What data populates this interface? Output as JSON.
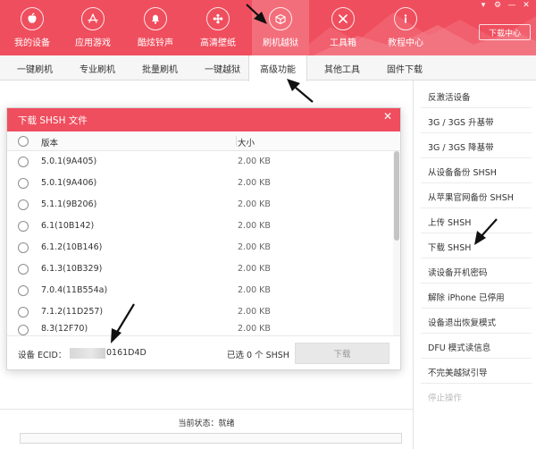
{
  "toolbar": {
    "items": [
      {
        "label": "我的设备",
        "icon": "apple-icon"
      },
      {
        "label": "应用游戏",
        "icon": "app-store-icon"
      },
      {
        "label": "酷炫铃声",
        "icon": "bell-icon"
      },
      {
        "label": "高清壁纸",
        "icon": "flower-icon"
      },
      {
        "label": "刷机越狱",
        "icon": "box-icon"
      },
      {
        "label": "工具箱",
        "icon": "tools-icon"
      },
      {
        "label": "教程中心",
        "icon": "info-icon"
      }
    ],
    "active_index": 4,
    "download_center": "下载中心",
    "accent_color": "#ef4e5e"
  },
  "subtabs": {
    "items": [
      "一键刷机",
      "专业刷机",
      "批量刷机",
      "一键越狱",
      "高级功能",
      "其他工具",
      "固件下载"
    ],
    "active_index": 4
  },
  "right_panel": {
    "items": [
      "反激活设备",
      "3G / 3GS 升基带",
      "3G / 3GS 降基带",
      "从设备备份 SHSH",
      "从苹果官网备份 SHSH",
      "上传 SHSH",
      "下载 SHSH",
      "读设备开机密码",
      "解除 iPhone 已停用",
      "设备退出恢复模式",
      "DFU 模式读信息",
      "不完美越狱引导",
      "停止操作"
    ],
    "disabled_last": true
  },
  "dialog": {
    "title": "下载 SHSH 文件",
    "columns": {
      "version": "版本",
      "size": "大小"
    },
    "rows": [
      {
        "version": "5.0.1(9A405)",
        "size": "2.00 KB"
      },
      {
        "version": "5.0.1(9A406)",
        "size": "2.00 KB"
      },
      {
        "version": "5.1.1(9B206)",
        "size": "2.00 KB"
      },
      {
        "version": "6.1(10B142)",
        "size": "2.00 KB"
      },
      {
        "version": "6.1.2(10B146)",
        "size": "2.00 KB"
      },
      {
        "version": "6.1.3(10B329)",
        "size": "2.00 KB"
      },
      {
        "version": "7.0.4(11B554a)",
        "size": "2.00 KB"
      },
      {
        "version": "7.1.2(11D257)",
        "size": "2.00 KB"
      },
      {
        "version": "8.3(12F70)",
        "size": "2.00 KB"
      }
    ],
    "ecid_label": "设备 ECID：",
    "ecid_suffix": "0161D4D",
    "selected_text": "已选 0 个 SHSH",
    "download_button": "下载"
  },
  "status": {
    "text": "当前状态：就绪"
  }
}
